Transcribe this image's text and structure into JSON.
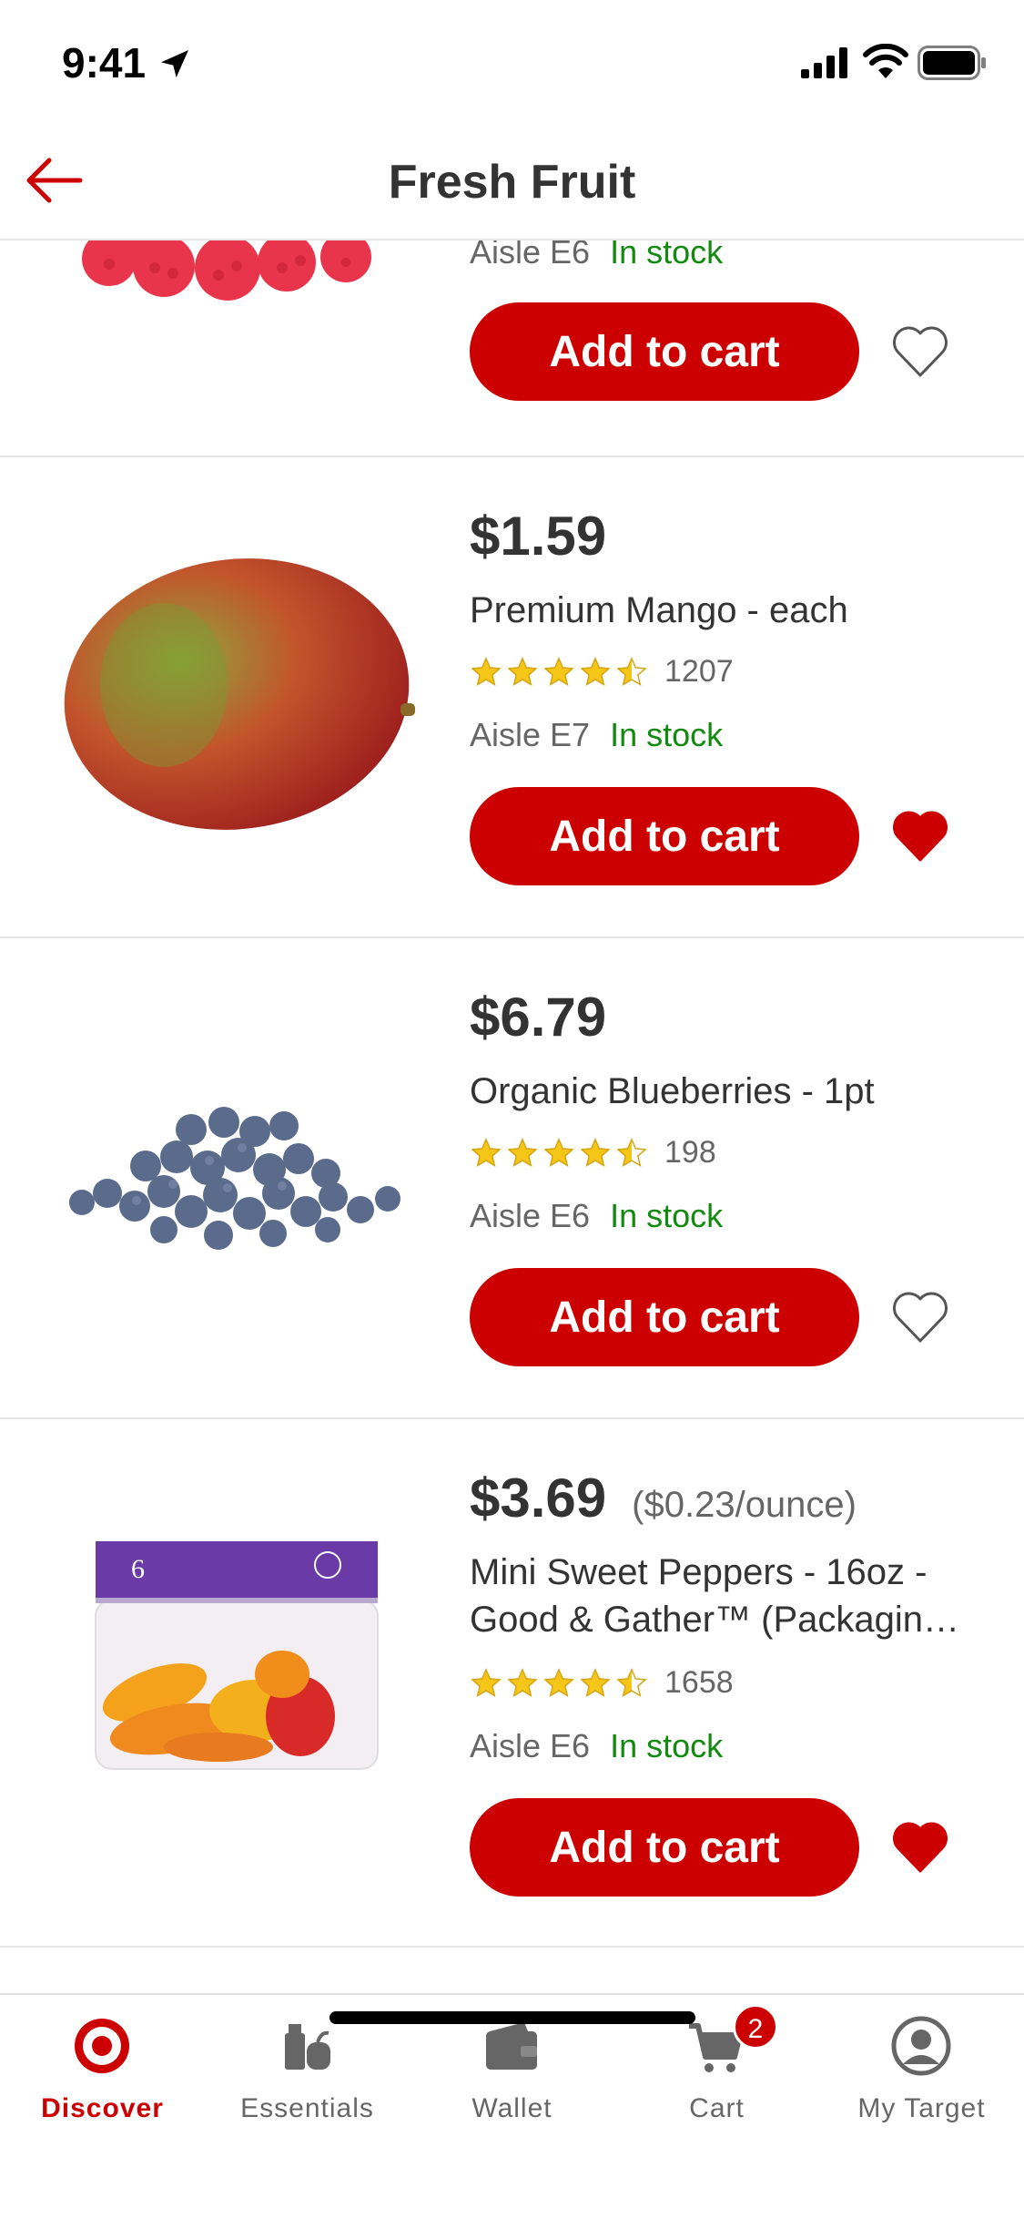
{
  "status_bar": {
    "time": "9:41"
  },
  "header": {
    "title": "Fresh Fruit"
  },
  "products": [
    {
      "image": "raspberries-image",
      "aisle": "Aisle E6",
      "stock": "In stock",
      "cta": "Add to cart",
      "favorited": false
    },
    {
      "image": "mango-image",
      "price": "$1.59",
      "name": "Premium Mango - each",
      "rating_value": 4.5,
      "rating_count": "1207",
      "aisle": "Aisle E7",
      "stock": "In stock",
      "cta": "Add to cart",
      "favorited": true
    },
    {
      "image": "blueberries-image",
      "price": "$6.79",
      "name": "Organic Blueberries - 1pt",
      "rating_value": 4.5,
      "rating_count": "198",
      "aisle": "Aisle E6",
      "stock": "In stock",
      "cta": "Add to cart",
      "favorited": false
    },
    {
      "image": "peppers-package-image",
      "price": "$3.69",
      "unit_price": "($0.23/ounce)",
      "name_line1": "Mini Sweet Peppers - 16oz -",
      "name_line2": "Good & Gather™ (Packagin…",
      "rating_value": 4.5,
      "rating_count": "1658",
      "aisle": "Aisle E6",
      "stock": "In stock",
      "cta": "Add to cart",
      "favorited": true
    }
  ],
  "tabbar": {
    "tabs": [
      {
        "label": "Discover",
        "icon": "target-bullseye-icon",
        "active": true
      },
      {
        "label": "Essentials",
        "icon": "essentials-icon",
        "active": false
      },
      {
        "label": "Wallet",
        "icon": "wallet-icon",
        "active": false
      },
      {
        "label": "Cart",
        "icon": "cart-icon",
        "active": false,
        "badge": "2"
      },
      {
        "label": "My Target",
        "icon": "profile-icon",
        "active": false
      }
    ]
  },
  "colors": {
    "brand_red": "#cc0000",
    "stock_green": "#118a0f",
    "star_gold": "#f5c518"
  }
}
